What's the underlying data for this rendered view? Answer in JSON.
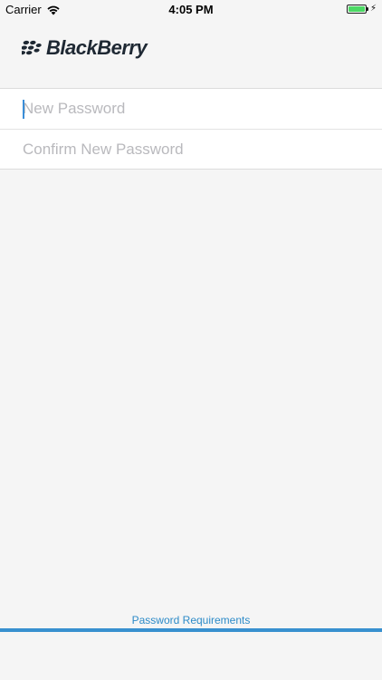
{
  "status_bar": {
    "carrier": "Carrier",
    "time": "4:05 PM",
    "battery_color": "#4cd964"
  },
  "logo": {
    "wordmark": "BlackBerry",
    "icon": "blackberry-logo-icon"
  },
  "form": {
    "new_password": {
      "value": "",
      "placeholder": "New Password"
    },
    "confirm_password": {
      "value": "",
      "placeholder": "Confirm New Password"
    }
  },
  "footer": {
    "requirements_link": "Password Requirements",
    "accent_color": "#3890cf"
  }
}
